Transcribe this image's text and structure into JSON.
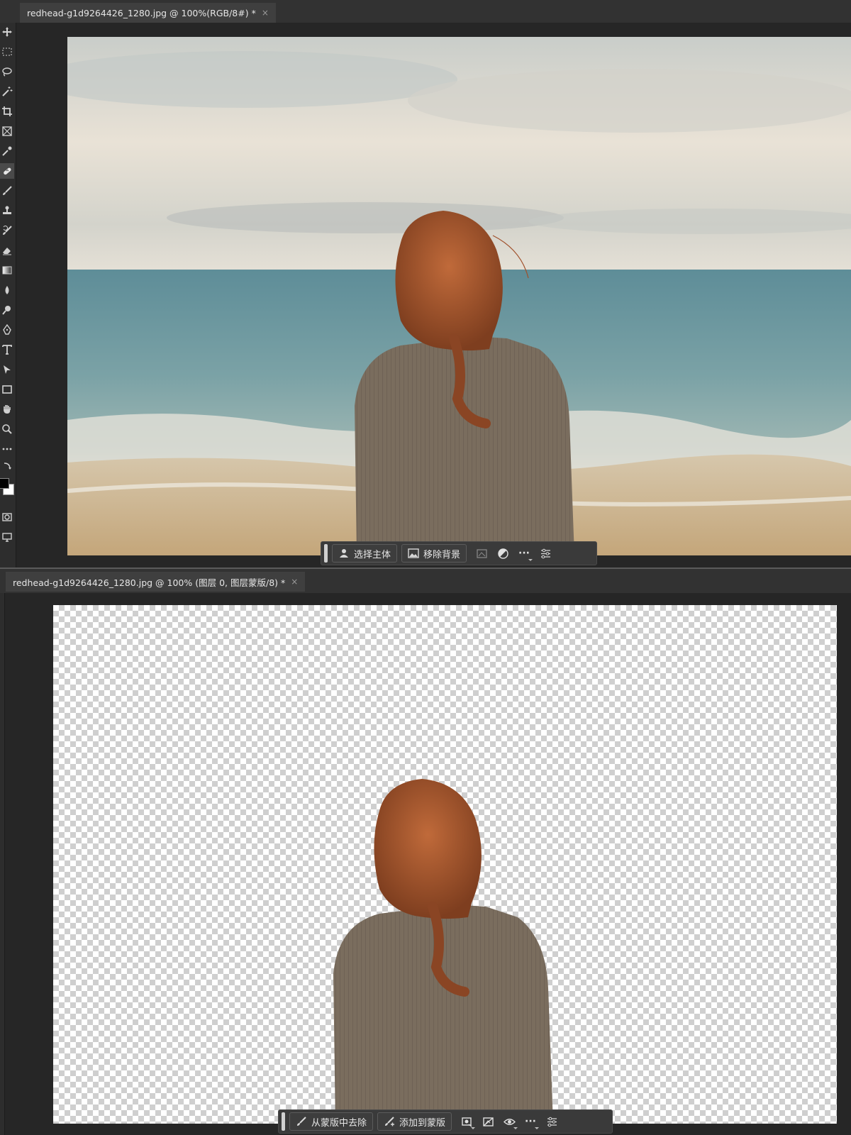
{
  "top_panel": {
    "tab": {
      "title": "redhead-g1d9264426_1280.jpg @ 100%(RGB/8#) *",
      "close": "×"
    },
    "context_bar": {
      "select_subject": "选择主体",
      "remove_background": "移除背景",
      "icons": [
        "transform-selection-icon",
        "contrast-icon",
        "more-options-icon",
        "settings-sliders-icon"
      ],
      "more": "···"
    }
  },
  "bottom_panel": {
    "tab": {
      "title": "redhead-g1d9264426_1280.jpg @ 100% (图层 0, 图层蒙版/8) *",
      "close": "×"
    },
    "context_bar": {
      "subtract_from_mask": "从蒙版中去除",
      "add_to_mask": "添加到蒙版",
      "icons": [
        "select-mask-icon",
        "invert-mask-icon",
        "visibility-eye-icon",
        "more-options-icon",
        "settings-sliders-icon"
      ],
      "more": "···"
    }
  },
  "toolbar": {
    "tools": [
      "move-tool-icon",
      "marquee-tool-icon",
      "lasso-tool-icon",
      "magic-wand-tool-icon",
      "crop-tool-icon",
      "frame-tool-icon",
      "eyedropper-tool-icon",
      "healing-brush-tool-icon",
      "brush-tool-icon",
      "clone-stamp-tool-icon",
      "history-brush-tool-icon",
      "eraser-tool-icon",
      "gradient-tool-icon",
      "blur-tool-icon",
      "dodge-tool-icon",
      "pen-tool-icon",
      "type-tool-icon",
      "path-selection-tool-icon",
      "rectangle-tool-icon",
      "hand-tool-icon",
      "zoom-tool-icon",
      "edit-toolbar-icon"
    ]
  },
  "colors": {
    "app_background": "#262626",
    "tab_background": "#3f3f3f",
    "sky": "#e9e3d8",
    "sea": "#6f9aa0",
    "sand": "#c9ad83",
    "hair": "#a8542b",
    "sweater": "#786b5c"
  }
}
